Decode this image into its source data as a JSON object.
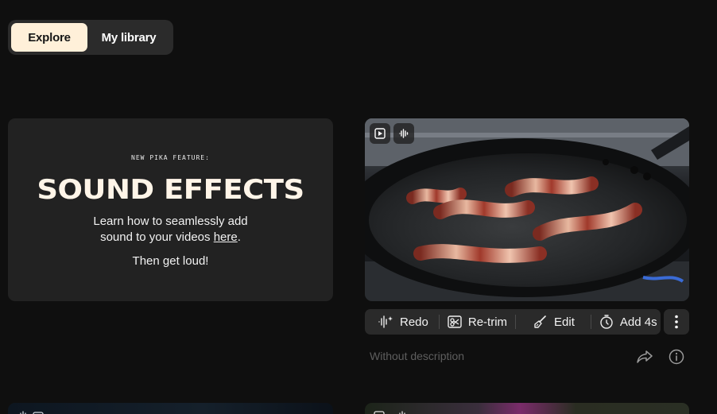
{
  "tabs": {
    "explore": "Explore",
    "library": "My library"
  },
  "promo": {
    "kicker": "NEW PIKA FEATURE:",
    "title": "SOUND EFFECTS",
    "body_line1": "Learn how to seamlessly add",
    "body_line2_prefix": "sound to your videos ",
    "body_link": "here",
    "body_line2_suffix": ".",
    "footer": "Then get loud!"
  },
  "video": {
    "badges": [
      "play-icon",
      "sound-wave-icon"
    ]
  },
  "toolbar": {
    "redo": "Redo",
    "retrim": "Re-trim",
    "edit": "Edit",
    "add": "Add 4s"
  },
  "description": "Without description",
  "colors": {
    "accent": "#fff0d9",
    "background": "#0f0f0f",
    "card": "#222222"
  }
}
